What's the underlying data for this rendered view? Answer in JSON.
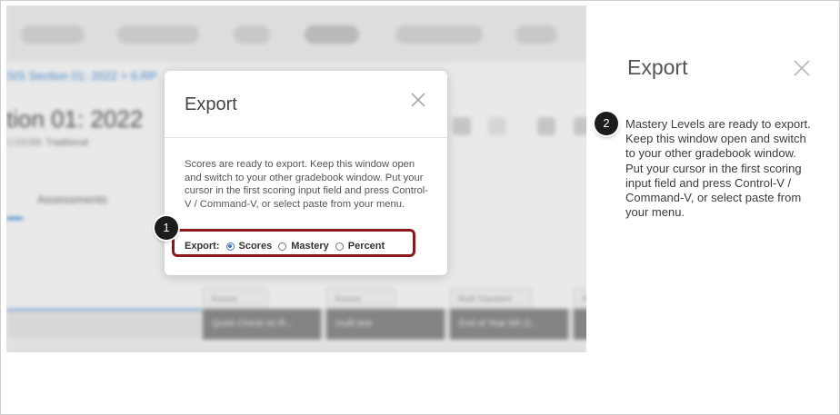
{
  "background_app": {
    "breadcrumb": "SIS Section 01: 2022 > 6.RP",
    "section_title": "tion 01: 2022",
    "subtitle": "l | CCSS: Traditional",
    "tab_assessments": "Assessments",
    "chips": [
      "Assess",
      "Assess",
      "Multi Standard",
      "A"
    ],
    "column_headers": [
      "Quick Check on R...",
      "multi test",
      "End of Year 6th G...",
      ""
    ]
  },
  "modal": {
    "title": "Export",
    "body": "Scores are ready to export. Keep this window open and switch to your other gradebook window. Put your cursor in the first scoring input field and press Control-V / Command-V, or select paste from your menu.",
    "export_label": "Export:",
    "options": [
      {
        "label": "Scores",
        "selected": true
      },
      {
        "label": "Mastery",
        "selected": false
      },
      {
        "label": "Percent",
        "selected": false
      }
    ]
  },
  "callouts": {
    "step1": "1",
    "step2": "2"
  },
  "panel": {
    "title": "Export",
    "text": "Mastery Levels are ready to export. Keep this window open and switch to your other gradebook window. Put your cursor in the first scoring input field and press Control-V / Command-V, or select paste from your menu."
  },
  "colors": {
    "accent": "#3a78c9",
    "highlight_border": "#8b1a1a",
    "step_badge": "#1c1c1c"
  }
}
